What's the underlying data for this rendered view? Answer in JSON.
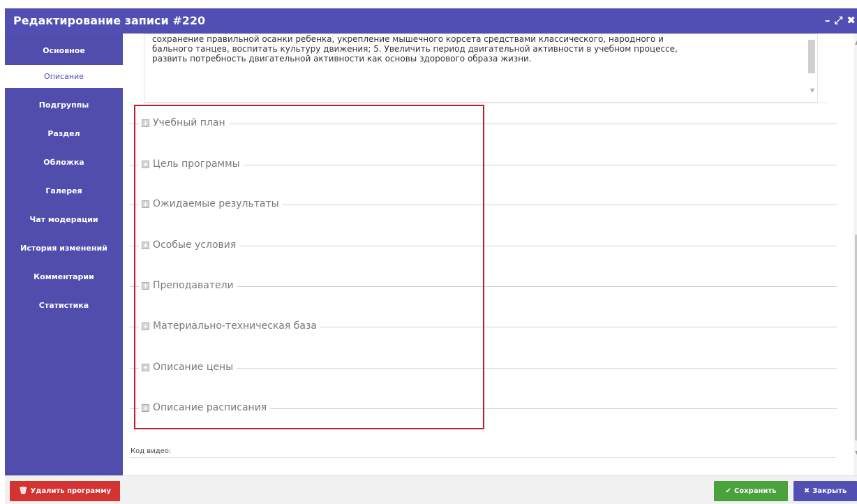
{
  "window": {
    "title": "Редактирование записи #220",
    "controls": {
      "minimize": "–",
      "maximize": "⤢",
      "close": "✖"
    }
  },
  "sidebar": {
    "items": [
      {
        "label": "Основное",
        "active": false
      },
      {
        "label": "Описание",
        "active": true
      },
      {
        "label": "Подгруппы",
        "active": false
      },
      {
        "label": "Раздел",
        "active": false
      },
      {
        "label": "Обложка",
        "active": false
      },
      {
        "label": "Галерея",
        "active": false
      },
      {
        "label": "Чат модерации",
        "active": false
      },
      {
        "label": "История изменений",
        "active": false
      },
      {
        "label": "Комментарии",
        "active": false
      },
      {
        "label": "Статистика",
        "active": false
      }
    ]
  },
  "description": {
    "lines": [
      "сохранение правильной осанки ребенка, укрепление мышечного корсета средствами классического, народного и",
      "бального танцев, воспитать культуру движения; 5. Увеличить период двигательной активности в учебном процессе,",
      "развить потребность двигательной активности как основы здорового образа жизни."
    ]
  },
  "sections": [
    {
      "label": "Учебный план",
      "icon": "plus-square-icon"
    },
    {
      "label": "Цель программы",
      "icon": "plus-square-icon"
    },
    {
      "label": "Ожидаемые результаты",
      "icon": "plus-square-icon"
    },
    {
      "label": "Особые условия",
      "icon": "plus-square-icon"
    },
    {
      "label": "Преподаватели",
      "icon": "plus-square-icon"
    },
    {
      "label": "Материально-техническая база",
      "icon": "plus-square-icon"
    },
    {
      "label": "Описание цены",
      "icon": "plus-square-icon"
    },
    {
      "label": "Описание расписания",
      "icon": "plus-square-icon"
    }
  ],
  "video": {
    "label": "Код видео:"
  },
  "footer": {
    "delete_label": "Удалить программу",
    "save_label": "Сохранить",
    "close_label": "Закрыть",
    "delete_icon": "trash-icon",
    "save_icon": "check-icon",
    "close_icon": "x-icon"
  },
  "colors": {
    "primary": "#514fb3",
    "danger": "#d53232",
    "success": "#4aa23d",
    "highlight": "#c21b25"
  }
}
